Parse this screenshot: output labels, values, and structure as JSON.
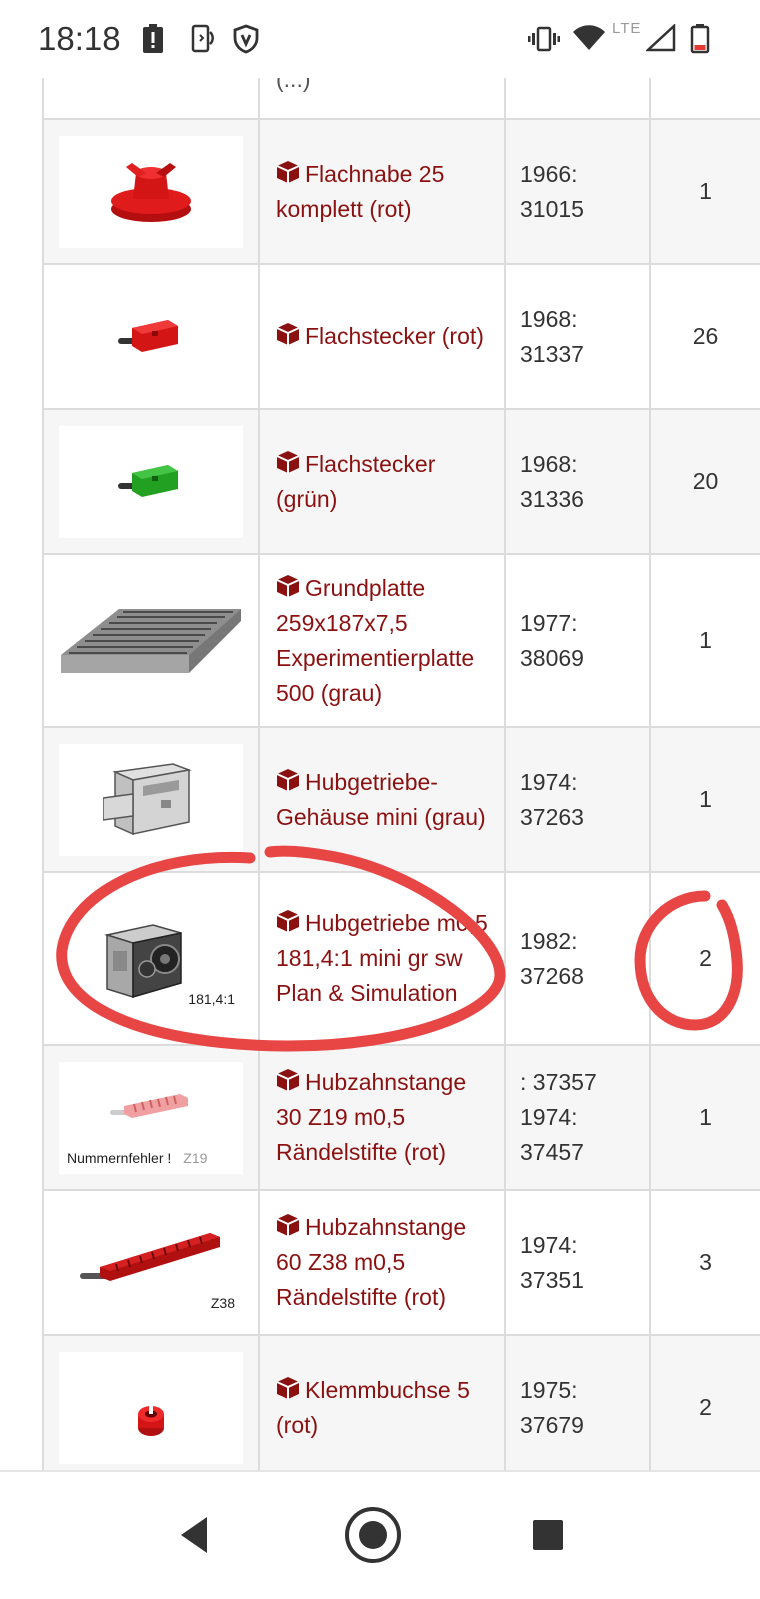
{
  "status_bar": {
    "time": "18:18",
    "network": "LTE",
    "icons": [
      "alert-icon",
      "screen-rotate-icon",
      "shield-icon",
      "vibrate-icon",
      "wifi-icon",
      "signal-icon",
      "battery-low-icon"
    ]
  },
  "colors": {
    "link": "#8b1111",
    "annotation": "#e84545",
    "border": "#dcdcdc"
  },
  "table": {
    "rows": [
      {
        "image": "partial-part-image",
        "name": "(...)",
        "article": "",
        "qty": ""
      },
      {
        "image": "flachnabe-red",
        "name": "Flachnabe 25 komplett (rot)",
        "article": "1966: 31015",
        "qty": "1"
      },
      {
        "image": "flachstecker-red",
        "name": "Flachstecker (rot)",
        "article": "1968: 31337",
        "qty": "26"
      },
      {
        "image": "flachstecker-green",
        "name": "Flachstecker (grün)",
        "article": "1968: 31336",
        "qty": "20"
      },
      {
        "image": "grundplatte-gray",
        "name": "Grundplatte 259x187x7,5 Experimentierplatte 500 (grau)",
        "article": "1977: 38069",
        "qty": "1"
      },
      {
        "image": "hubgetriebe-gehaeuse",
        "name": "Hubgetriebe-Gehäuse mini (grau)",
        "article": "1974: 37263",
        "qty": "1"
      },
      {
        "image": "hubgetriebe-motor",
        "caption": "181,4:1",
        "name": "Hubgetriebe m0,5 181,4:1 mini gr sw Plan & Simulation",
        "article": "1982: 37268",
        "qty": "2"
      },
      {
        "image": "hubzahnstange-30",
        "caption_left": "Nummernfehler !",
        "caption_gray": "Z19",
        "name": "Hubzahnstange 30 Z19 m0,5 Rändelstifte (rot)",
        "article": ": 37357 1974: 37457",
        "qty": "1"
      },
      {
        "image": "hubzahnstange-60",
        "caption": "Z38",
        "name": "Hubzahnstange 60 Z38 m0,5 Rändelstifte (rot)",
        "article": "1974: 37351",
        "qty": "3"
      },
      {
        "image": "klemmbuchse-red",
        "name": "Klemmbuchse 5 (rot)",
        "article": "1975: 37679",
        "qty": "2"
      }
    ]
  },
  "nav": {
    "buttons": [
      "back-icon",
      "home-icon",
      "recents-icon"
    ]
  }
}
